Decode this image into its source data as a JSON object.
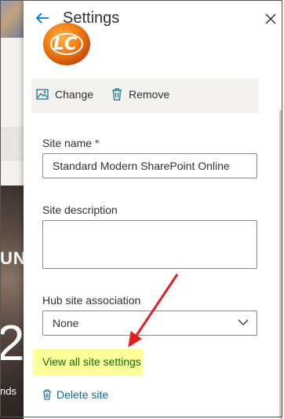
{
  "panel": {
    "title": "Settings",
    "logo_text": "LC",
    "actions": {
      "change_label": "Change",
      "remove_label": "Remove"
    },
    "fields": {
      "site_name": {
        "label": "Site name",
        "required_mark": "*",
        "value": "Standard Modern SharePoint Online"
      },
      "site_description": {
        "label": "Site description",
        "value": ""
      },
      "hub_site": {
        "label": "Hub site association",
        "value": "None"
      }
    },
    "links": {
      "view_all": "View all site settings",
      "delete": "Delete site"
    }
  },
  "background": {
    "text1": "UN",
    "text2": "2",
    "text3": "nds"
  },
  "colors": {
    "accent": "#0078d4",
    "highlight": "#ffff99",
    "arrow": "#e02020",
    "link_green": "#0a6e0a",
    "link_blue": "#0b6a8c"
  }
}
